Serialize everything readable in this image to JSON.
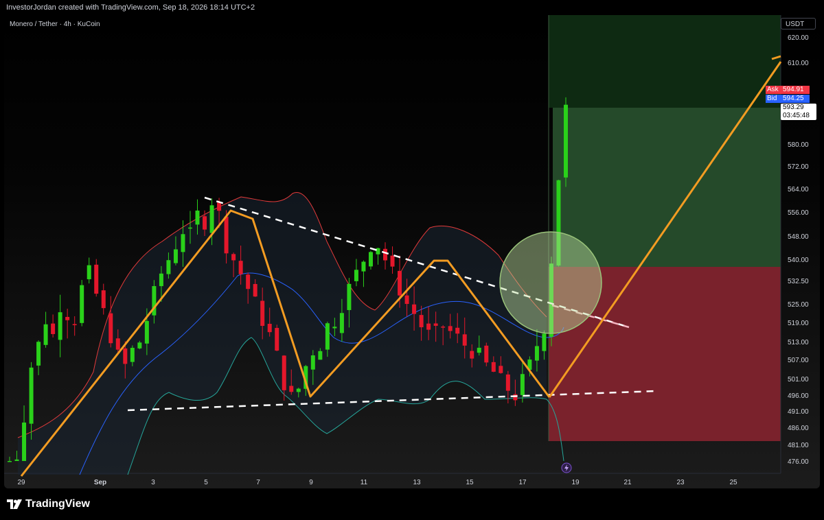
{
  "header": {
    "credit": "InvestorJordan created with TradingView.com, Sep 18, 2026 18:14 UTC+2"
  },
  "chart_header": {
    "symbol_line": "Monero / Tether · 4h · KuCoin"
  },
  "currency": "USDT",
  "brand": {
    "name": "TradingView",
    "icon": "tradingview-logo-icon"
  },
  "price_axis": {
    "labels": [
      "620.00",
      "610.00",
      "580.00",
      "572.00",
      "564.00",
      "556.00",
      "548.00",
      "540.00",
      "532.50",
      "525.00",
      "519.00",
      "513.00",
      "507.00",
      "501.00",
      "496.00",
      "491.00",
      "486.00",
      "481.00",
      "476.00"
    ]
  },
  "time_axis": {
    "labels": [
      "29",
      "Sep",
      "3",
      "5",
      "7",
      "9",
      "11",
      "13",
      "15",
      "17",
      "19",
      "21",
      "23",
      "25"
    ]
  },
  "quotes": {
    "ask_label": "Ask",
    "ask": "594.91",
    "bid_label": "Bid",
    "bid": "594.25",
    "last": "593.29",
    "countdown": "03:45:48"
  },
  "icons": {
    "lightning": "lightning-icon"
  },
  "colors": {
    "up": "#2ad11a",
    "down": "#e4172b",
    "pattern": "#f39c22",
    "target": "#2e7d32",
    "stop": "#8e2430",
    "ask": "#f23645",
    "bid": "#2962ff",
    "mid_band": "#2962ff",
    "upper_band": "#e33a3a",
    "lower_band": "#26a69a"
  },
  "chart_data": {
    "type": "candlestick",
    "instrument": "Monero / Tether",
    "timeframe": "4h",
    "exchange": "KuCoin",
    "y_ticks": [
      620,
      610,
      580,
      572,
      564,
      556,
      548,
      540,
      532.5,
      525,
      519,
      513,
      507,
      501,
      496,
      491,
      486,
      481,
      476
    ],
    "x_ticks": [
      "29",
      "Sep",
      "3",
      "5",
      "7",
      "9",
      "11",
      "13",
      "15",
      "17",
      "19",
      "21",
      "23",
      "25"
    ],
    "last_price": 593.29,
    "ask": 594.91,
    "bid": 594.25,
    "position": {
      "entry": 537,
      "target": 590,
      "stop": 482.5
    },
    "pattern_points_approx": [
      [
        28.8,
        473
      ],
      [
        5.8,
        558
      ],
      [
        8.9,
        497
      ],
      [
        13.6,
        540
      ],
      [
        17.7,
        496
      ],
      [
        22.6,
        611
      ]
    ],
    "upper_trendline_approx": [
      [
        5.8,
        560
      ],
      [
        20.1,
        517
      ]
    ],
    "lower_trendline_approx": [
      [
        30.6,
        492
      ],
      [
        20.5,
        498
      ]
    ],
    "candles_close_approx": [
      474,
      478,
      490,
      505,
      512,
      520,
      515,
      525,
      522,
      520,
      530,
      535,
      528,
      522,
      515,
      508,
      505,
      510,
      513,
      520,
      528,
      535,
      540,
      545,
      550,
      548,
      555,
      553,
      560,
      555,
      545,
      540,
      535,
      530,
      525,
      520,
      515,
      508,
      500,
      495,
      498,
      505,
      510,
      512,
      518,
      520,
      525,
      530,
      535,
      540,
      545,
      545,
      540,
      535,
      530,
      525,
      522,
      518,
      515,
      515,
      518,
      516,
      514,
      512,
      510,
      508,
      505,
      503,
      500,
      498,
      496,
      500,
      505,
      512,
      518,
      540,
      568,
      593
    ]
  }
}
